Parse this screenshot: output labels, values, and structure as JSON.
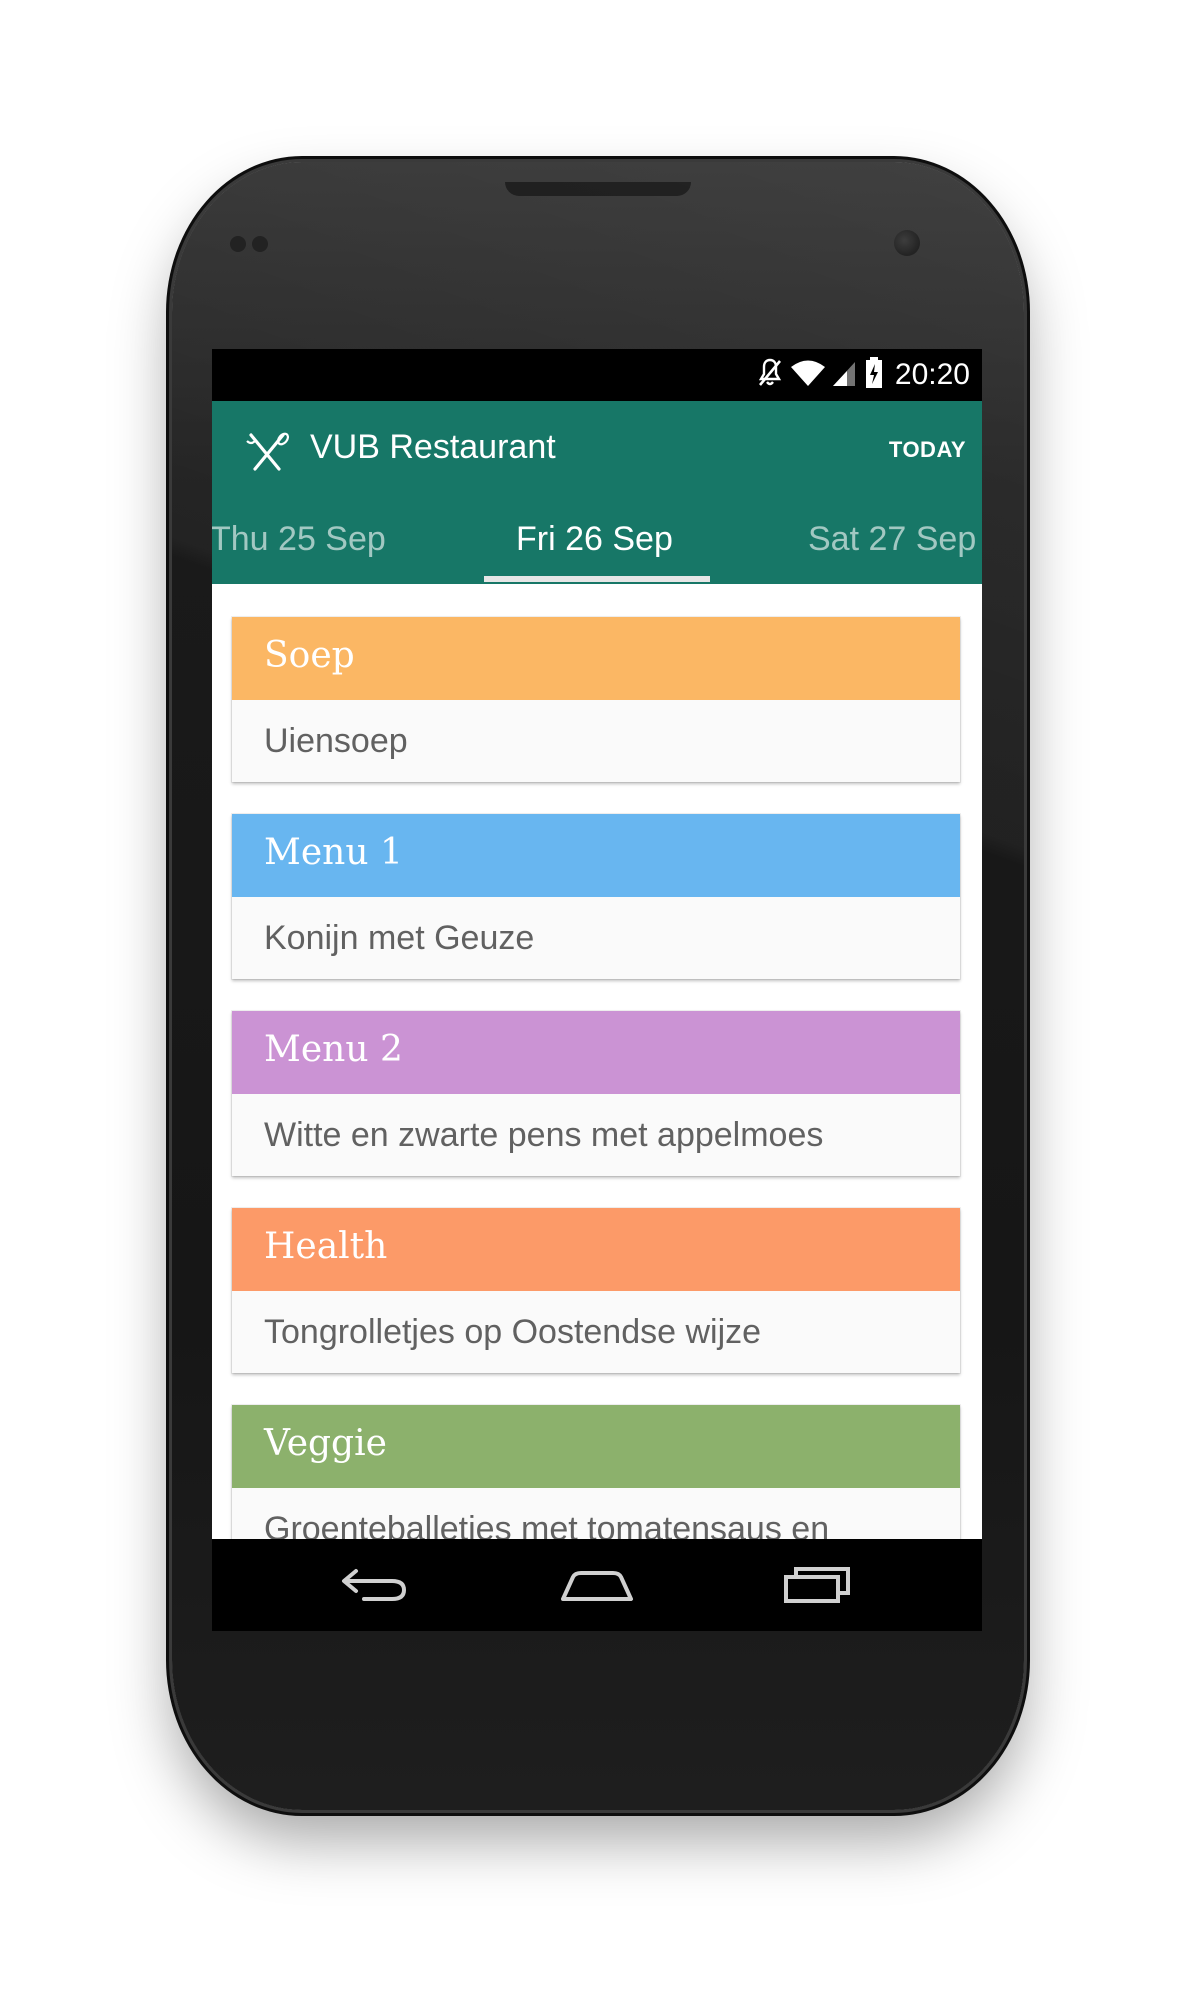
{
  "status_bar": {
    "time": "20:20",
    "icons": [
      "mute-icon",
      "wifi-icon",
      "signal-icon",
      "battery-charging-icon"
    ]
  },
  "action_bar": {
    "app_icon": "cutlery-icon",
    "title": "VUB Restaurant",
    "today_label": "TODAY"
  },
  "tabs": [
    {
      "label": "Thu 25 Sep",
      "selected": false
    },
    {
      "label": "Fri 26 Sep",
      "selected": true
    },
    {
      "label": "Sat 27 Sep",
      "selected": false
    }
  ],
  "menu": [
    {
      "category": "Soep",
      "dish": "Uiensoep",
      "color": "#FBB764"
    },
    {
      "category": "Menu 1",
      "dish": "Konijn met Geuze",
      "color": "#68B6F0"
    },
    {
      "category": "Menu 2",
      "dish": "Witte en zwarte pens met appelmoes",
      "color": "#CB93D4"
    },
    {
      "category": "Health",
      "dish": "Tongrolletjes op Oostendse wijze",
      "color": "#FC9A68"
    },
    {
      "category": "Veggie",
      "dish": "Groenteballetjes met tomatensaus en",
      "color": "#8CB16C"
    }
  ],
  "nav_bar": {
    "buttons": [
      "back-icon",
      "home-icon",
      "recent-apps-icon"
    ]
  },
  "colors": {
    "primary": "#177767",
    "status_bar": "#000000",
    "card_background": "#FAFAFA",
    "body_text": "#616161"
  }
}
